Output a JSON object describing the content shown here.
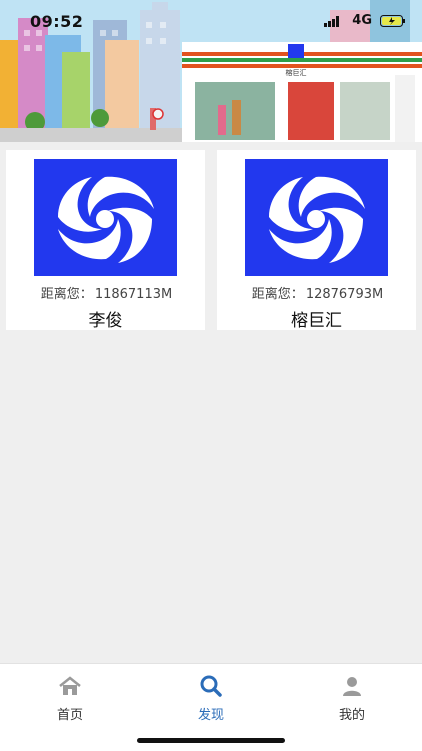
{
  "status_bar": {
    "time": "09:52",
    "network": "4G"
  },
  "banner": {
    "shop_sign": "榕巨汇"
  },
  "stores": [
    {
      "distance_label": "距离您：",
      "distance_value": "11867113M",
      "name": "李俊"
    },
    {
      "distance_label": "距离您：",
      "distance_value": "12876793M",
      "name": "榕巨汇"
    }
  ],
  "tabbar": {
    "items": [
      {
        "label": "首页",
        "icon": "home-icon",
        "active": false
      },
      {
        "label": "发现",
        "icon": "search-icon",
        "active": true
      },
      {
        "label": "我的",
        "icon": "user-icon",
        "active": false
      }
    ]
  },
  "colors": {
    "logo_bg": "#2238ee",
    "active_tab": "#2b6cb8",
    "page_bg": "#efefef"
  }
}
